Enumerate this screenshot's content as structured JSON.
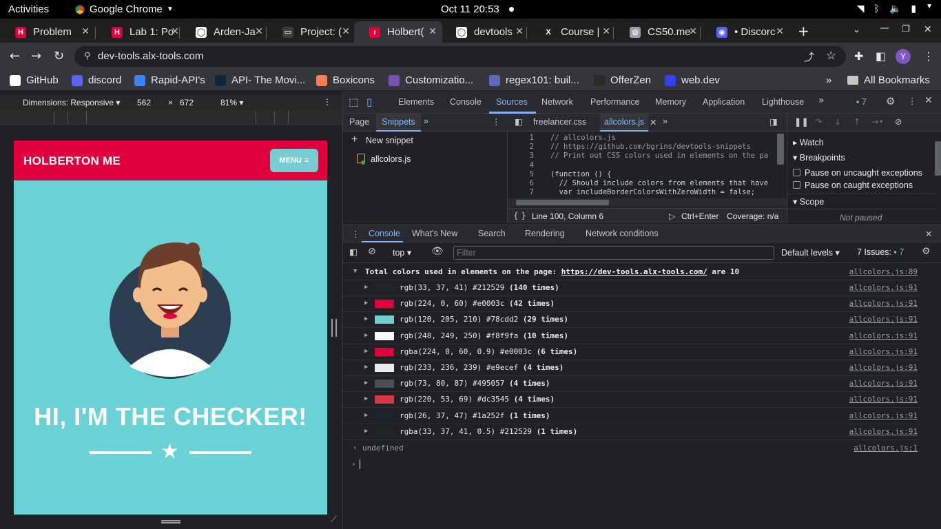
{
  "topbar": {
    "activities": "Activities",
    "app_name": "Google Chrome",
    "clock": "Oct 11  20:53"
  },
  "tabs": [
    {
      "title": "Problem",
      "color": "#e0003c",
      "glyph": "H"
    },
    {
      "title": "Lab 1: Po",
      "color": "#e0003c",
      "glyph": "H"
    },
    {
      "title": "Arden-Ja",
      "color": "#ffffff",
      "glyph": "◯"
    },
    {
      "title": "Project: (",
      "color": "#3c3c3c",
      "glyph": "▭"
    },
    {
      "title": "Holbert(",
      "color": "#e0003c",
      "glyph": "ı"
    },
    {
      "title": "devtools",
      "color": "#ffffff",
      "glyph": "◯"
    },
    {
      "title": "Course |",
      "color": "#202124",
      "glyph": "X"
    },
    {
      "title": "CS50.me",
      "color": "#9aa0a6",
      "glyph": "◍"
    },
    {
      "title": "• Discorc",
      "color": "#5865f2",
      "glyph": "◉"
    }
  ],
  "active_tab": 4,
  "omnibox": {
    "url": "dev-tools.alx-tools.com"
  },
  "profile_initial": "Y",
  "bookmarks": [
    {
      "label": "GitHub",
      "color": "#ffffff"
    },
    {
      "label": "discord",
      "color": "#5865f2"
    },
    {
      "label": "Rapid-API's",
      "color": "#3b82f6"
    },
    {
      "label": "API- The Movi...",
      "color": "#0d253f"
    },
    {
      "label": "Boxicons",
      "color": "#ff7a59"
    },
    {
      "label": "Customizatio...",
      "color": "#7952b3"
    },
    {
      "label": "regex101: buil...",
      "color": "#5c6bc0"
    },
    {
      "label": "OfferZen",
      "color": "#2b2b2b"
    },
    {
      "label": "web.dev",
      "color": "#3740ff"
    }
  ],
  "bookmarks_folder": "All Bookmarks",
  "device": {
    "dimensions_label": "Dimensions: Responsive",
    "width": "562",
    "times": "×",
    "height": "672",
    "zoom": "81%"
  },
  "page": {
    "brand": "HOLBERTON ME",
    "menu_label": "MENU",
    "hero_title": "HI, I'M THE CHECKER!"
  },
  "devtools": {
    "tabs": [
      "Elements",
      "Console",
      "Sources",
      "Network",
      "Performance",
      "Memory",
      "Application",
      "Lighthouse"
    ],
    "active_tab": "Sources",
    "issues_count": "7",
    "nav_tabs": [
      "Page",
      "Snippets"
    ],
    "new_snippet": "New snippet",
    "snippet_file": "allcolors.js",
    "editor_tabs": [
      "freelancer.css",
      "allcolors.js"
    ],
    "code_lines": [
      {
        "n": "1",
        "text": "// allcolors.js"
      },
      {
        "n": "2",
        "text": "// https://github.com/bgrins/devtools-snippets"
      },
      {
        "n": "3",
        "text": "// Print out CSS colors used in elements on the pa"
      },
      {
        "n": "4",
        "text": ""
      },
      {
        "n": "5",
        "text": "(function () {"
      },
      {
        "n": "6",
        "text": "  // Should include colors from elements that have"
      },
      {
        "n": "7",
        "text": "  var includeBorderColorsWithZeroWidth = false;"
      }
    ],
    "cursor_pos": "Line 100, Column 6",
    "run_hint": "Ctrl+Enter",
    "coverage": "Coverage: n/a",
    "debug_sections": {
      "watch": "Watch",
      "breakpoints": "Breakpoints",
      "pause_uncaught": "Pause on uncaught exceptions",
      "pause_caught": "Pause on caught exceptions",
      "scope": "Scope",
      "not_paused": "Not paused"
    },
    "drawer_tabs": [
      "Console",
      "What's New",
      "Search",
      "Rendering",
      "Network conditions"
    ],
    "console_toolbar": {
      "context": "top",
      "filter_placeholder": "Filter",
      "levels": "Default levels",
      "issues_label": "7 Issues:",
      "issues_count": "7"
    }
  },
  "console": {
    "summary_prefix": "Total colors used in elements on the page: ",
    "summary_url": "https://dev-tools.alx-tools.com/",
    "summary_suffix": " are 10",
    "summary_src": "allcolors.js:89",
    "rows": [
      {
        "swatch": "#212529",
        "text": "rgb(33, 37, 41) #212529 ",
        "count": "(140 times)",
        "src": "allcolors.js:91"
      },
      {
        "swatch": "#e0003c",
        "text": "rgb(224, 0, 60) #e0003c ",
        "count": "(42 times)",
        "src": "allcolors.js:91"
      },
      {
        "swatch": "#78cdd2",
        "text": "rgb(120, 205, 210) #78cdd2 ",
        "count": "(29 times)",
        "src": "allcolors.js:91"
      },
      {
        "swatch": "#f8f9fa",
        "text": "rgb(248, 249, 250) #f8f9fa ",
        "count": "(10 times)",
        "src": "allcolors.js:91"
      },
      {
        "swatch": "#e0003c",
        "text": "rgba(224, 0, 60, 0.9) #e0003c ",
        "count": "(6 times)",
        "src": "allcolors.js:91"
      },
      {
        "swatch": "#e9ecef",
        "text": "rgb(233, 236, 239) #e9ecef ",
        "count": "(4 times)",
        "src": "allcolors.js:91"
      },
      {
        "swatch": "#495057",
        "text": "rgb(73, 80, 87) #495057 ",
        "count": "(4 times)",
        "src": "allcolors.js:91"
      },
      {
        "swatch": "#dc3545",
        "text": "rgb(220, 53, 69) #dc3545 ",
        "count": "(4 times)",
        "src": "allcolors.js:91"
      },
      {
        "swatch": "#1a252f",
        "text": "rgb(26, 37, 47) #1a252f ",
        "count": "(1 times)",
        "src": "allcolors.js:91"
      },
      {
        "swatch": "#212529",
        "text": "rgba(33, 37, 41, 0.5) #212529 ",
        "count": "(1 times)",
        "src": "allcolors.js:91"
      }
    ],
    "return_value": "undefined",
    "return_src": "allcolors.js:1"
  }
}
